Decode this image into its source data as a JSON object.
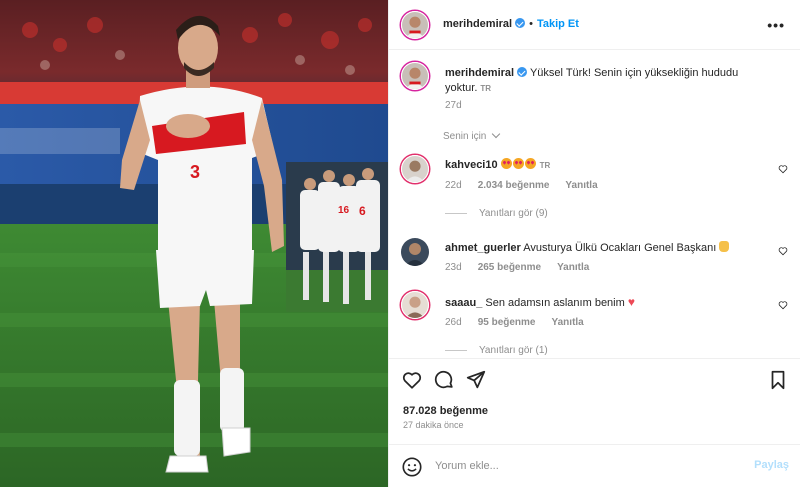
{
  "post": {
    "author": "merihdemiral",
    "follow_label": "Takip Et",
    "more_icon": "more-horizontal-icon",
    "jersey_number": "3",
    "team_numbers": [
      "6",
      "16"
    ],
    "caption": {
      "text": "Yüksel Türk! Senin için yüksekliğin hududu yoktur.",
      "translate_badge": "TR",
      "age": "27d"
    },
    "for_you_label": "Senin için"
  },
  "comments": [
    {
      "user": "kahveci10",
      "text": "",
      "emoji": "heart-eyes-emoji x3",
      "translate_badge": "TR",
      "age": "22d",
      "likes": "2.034 beğenme",
      "reply_label": "Yanıtla",
      "view_replies": "Yanıtları gör (9)"
    },
    {
      "user": "ahmet_guerler",
      "text": "Avusturya Ülkü Ocakları Genel Başkanı",
      "emoji": "wolf-hand-emoji",
      "age": "23d",
      "likes": "265 beğenme",
      "reply_label": "Yanıtla"
    },
    {
      "user": "saaau_",
      "text": "Sen adamsın aslanım benim",
      "emoji": "red-heart-emoji",
      "heart_char": "♥",
      "age": "26d",
      "likes": "95 beğenme",
      "reply_label": "Yanıtla",
      "view_replies": "Yanıtları gör (1)"
    }
  ],
  "footer": {
    "likes": "87.028 beğenme",
    "time": "27 dakika önce",
    "comment_placeholder": "Yorum ekle...",
    "share_label": "Paylaş"
  },
  "colors": {
    "accent": "#0095f6",
    "verified": "#3897f0",
    "jersey_red": "#d71920",
    "pitch_green": "#3a7a2f"
  }
}
